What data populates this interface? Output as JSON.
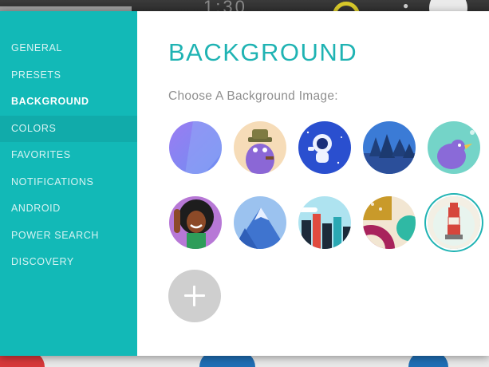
{
  "background_app": {
    "clock": "1:30"
  },
  "sidebar": {
    "items": [
      {
        "label": "GENERAL"
      },
      {
        "label": "PRESETS"
      },
      {
        "label": "BACKGROUND"
      },
      {
        "label": "COLORS"
      },
      {
        "label": "FAVORITES"
      },
      {
        "label": "NOTIFICATIONS"
      },
      {
        "label": "ANDROID"
      },
      {
        "label": "POWER SEARCH"
      },
      {
        "label": "DISCOVERY"
      }
    ],
    "active": "BACKGROUND",
    "hovered": "COLORS"
  },
  "main": {
    "title": "BACKGROUND",
    "subtitle": "Choose A Background Image:",
    "images": [
      {
        "name": "purple-gradient",
        "selected": false
      },
      {
        "name": "monster-with-pipe",
        "selected": false
      },
      {
        "name": "astronaut",
        "selected": false
      },
      {
        "name": "pine-forest",
        "selected": false
      },
      {
        "name": "purple-bird",
        "selected": false
      },
      {
        "name": "afro-woman",
        "selected": false
      },
      {
        "name": "mountain",
        "selected": false
      },
      {
        "name": "city-skyline",
        "selected": false
      },
      {
        "name": "abstract-shapes",
        "selected": false
      },
      {
        "name": "lighthouse",
        "selected": true
      }
    ],
    "add_icon": "plus-icon"
  },
  "colors": {
    "sidebar": "#12b9b7",
    "accent": "#1fb3b3",
    "subtitle": "#8f8f8f"
  }
}
